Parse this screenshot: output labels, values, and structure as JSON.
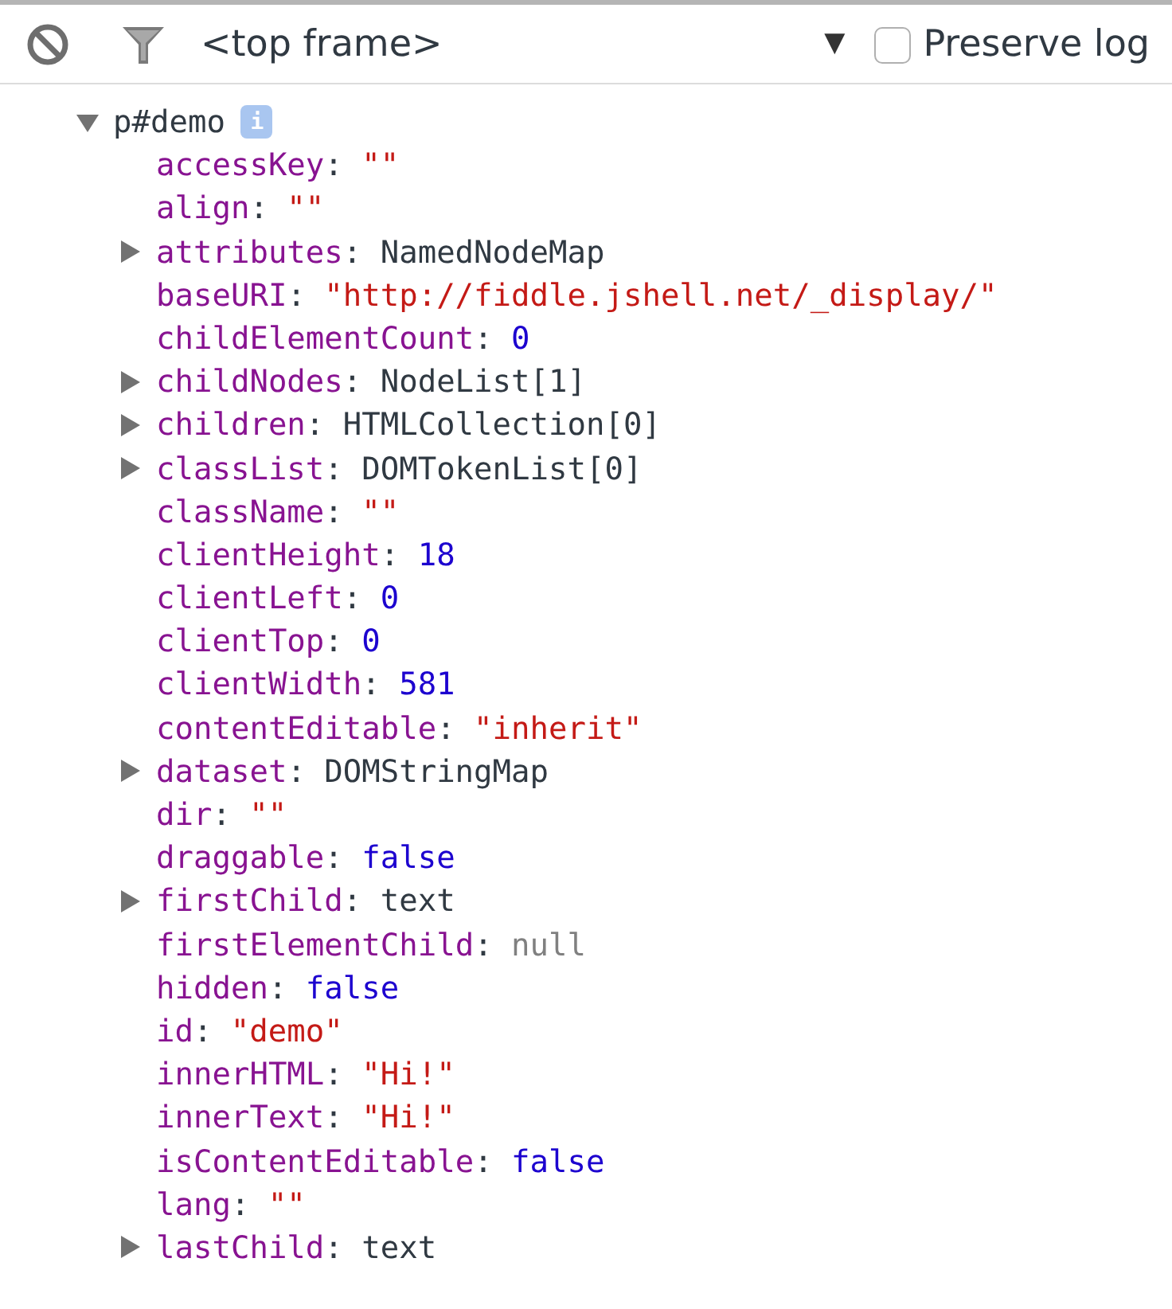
{
  "toolbar": {
    "context": "<top frame>",
    "dropdown_arrow": "▼",
    "preserve_log": {
      "label": "Preserve log",
      "checked": false
    }
  },
  "root": {
    "label": "p#demo",
    "badge": "i",
    "expanded": true,
    "separator": ":",
    "properties": [
      {
        "name": "accessKey",
        "value": "\"\"",
        "color": "#c41a16",
        "kind": "leaf"
      },
      {
        "name": "align",
        "value": "\"\"",
        "color": "#c41a16",
        "kind": "leaf"
      },
      {
        "name": "attributes",
        "value": "NamedNodeMap",
        "color": "#303942",
        "kind": "expandable",
        "expanded": false
      },
      {
        "name": "baseURI",
        "value": "\"http://fiddle.jshell.net/_display/\"",
        "color": "#c41a16",
        "kind": "leaf"
      },
      {
        "name": "childElementCount",
        "value": "0",
        "color": "#1c00cf",
        "kind": "leaf"
      },
      {
        "name": "childNodes",
        "value": "NodeList[1]",
        "color": "#303942",
        "kind": "expandable",
        "expanded": false
      },
      {
        "name": "children",
        "value": "HTMLCollection[0]",
        "color": "#303942",
        "kind": "expandable",
        "expanded": false
      },
      {
        "name": "classList",
        "value": "DOMTokenList[0]",
        "color": "#303942",
        "kind": "expandable",
        "expanded": false
      },
      {
        "name": "className",
        "value": "\"\"",
        "color": "#c41a16",
        "kind": "leaf"
      },
      {
        "name": "clientHeight",
        "value": "18",
        "color": "#1c00cf",
        "kind": "leaf"
      },
      {
        "name": "clientLeft",
        "value": "0",
        "color": "#1c00cf",
        "kind": "leaf"
      },
      {
        "name": "clientTop",
        "value": "0",
        "color": "#1c00cf",
        "kind": "leaf"
      },
      {
        "name": "clientWidth",
        "value": "581",
        "color": "#1c00cf",
        "kind": "leaf"
      },
      {
        "name": "contentEditable",
        "value": "\"inherit\"",
        "color": "#c41a16",
        "kind": "leaf"
      },
      {
        "name": "dataset",
        "value": "DOMStringMap",
        "color": "#303942",
        "kind": "expandable",
        "expanded": false
      },
      {
        "name": "dir",
        "value": "\"\"",
        "color": "#c41a16",
        "kind": "leaf"
      },
      {
        "name": "draggable",
        "value": "false",
        "color": "#1c00cf",
        "kind": "leaf"
      },
      {
        "name": "firstChild",
        "value": "text",
        "color": "#303942",
        "kind": "expandable",
        "expanded": false
      },
      {
        "name": "firstElementChild",
        "value": "null",
        "color": "#808080",
        "kind": "leaf"
      },
      {
        "name": "hidden",
        "value": "false",
        "color": "#1c00cf",
        "kind": "leaf"
      },
      {
        "name": "id",
        "value": "\"demo\"",
        "color": "#c41a16",
        "kind": "leaf"
      },
      {
        "name": "innerHTML",
        "value": "\"Hi!\"",
        "color": "#c41a16",
        "kind": "leaf"
      },
      {
        "name": "innerText",
        "value": "\"Hi!\"",
        "color": "#c41a16",
        "kind": "leaf"
      },
      {
        "name": "isContentEditable",
        "value": "false",
        "color": "#1c00cf",
        "kind": "leaf"
      },
      {
        "name": "lang",
        "value": "\"\"",
        "color": "#c41a16",
        "kind": "leaf"
      },
      {
        "name": "lastChild",
        "value": "text",
        "color": "#303942",
        "kind": "expandable",
        "expanded": false
      }
    ]
  }
}
